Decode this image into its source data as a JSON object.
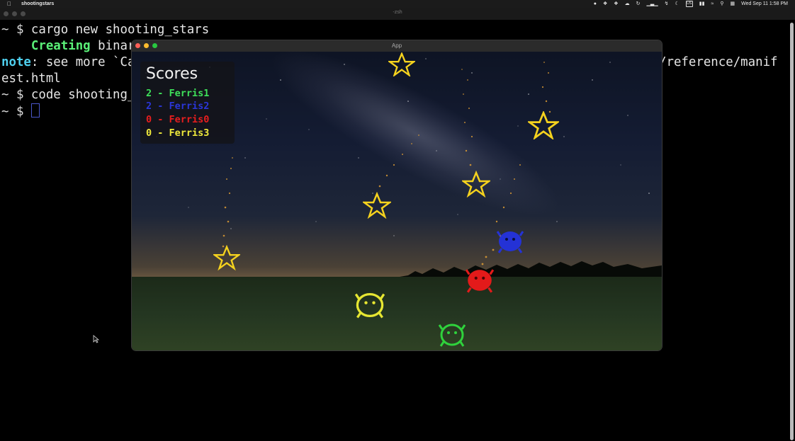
{
  "menubar": {
    "app_name": "shootingstars",
    "keyboard": "US",
    "datetime": "Wed Sep 11  1:58 PM"
  },
  "terminal": {
    "title": "-zsh",
    "lines": [
      {
        "prompt": "~ $ ",
        "text": "cargo new shooting_stars"
      },
      {
        "indent": "    ",
        "status": "Creating",
        "text": " binar"
      },
      {
        "label": "note",
        "text": ": see more `Ca",
        "tail": "/reference/manif"
      },
      {
        "text": "est.html"
      },
      {
        "prompt": "~ $ ",
        "text": "code shooting_"
      },
      {
        "prompt": "~ $ ",
        "text": ""
      }
    ]
  },
  "app": {
    "title": "App",
    "scoreboard": {
      "title": "Scores",
      "rows": [
        {
          "text": "2 - Ferris1",
          "color": "#3ee05a"
        },
        {
          "text": "2 - Ferris2",
          "color": "#2a36d8"
        },
        {
          "text": "0 - Ferris0",
          "color": "#e81e1e"
        },
        {
          "text": "0 - Ferris3",
          "color": "#f0ea3c"
        }
      ]
    },
    "colors": {
      "star": "#f5d21e",
      "ferris_green": "#2fd23c",
      "ferris_blue": "#2432d6",
      "ferris_red": "#e31a1a",
      "ferris_yellow": "#e6e632"
    }
  }
}
